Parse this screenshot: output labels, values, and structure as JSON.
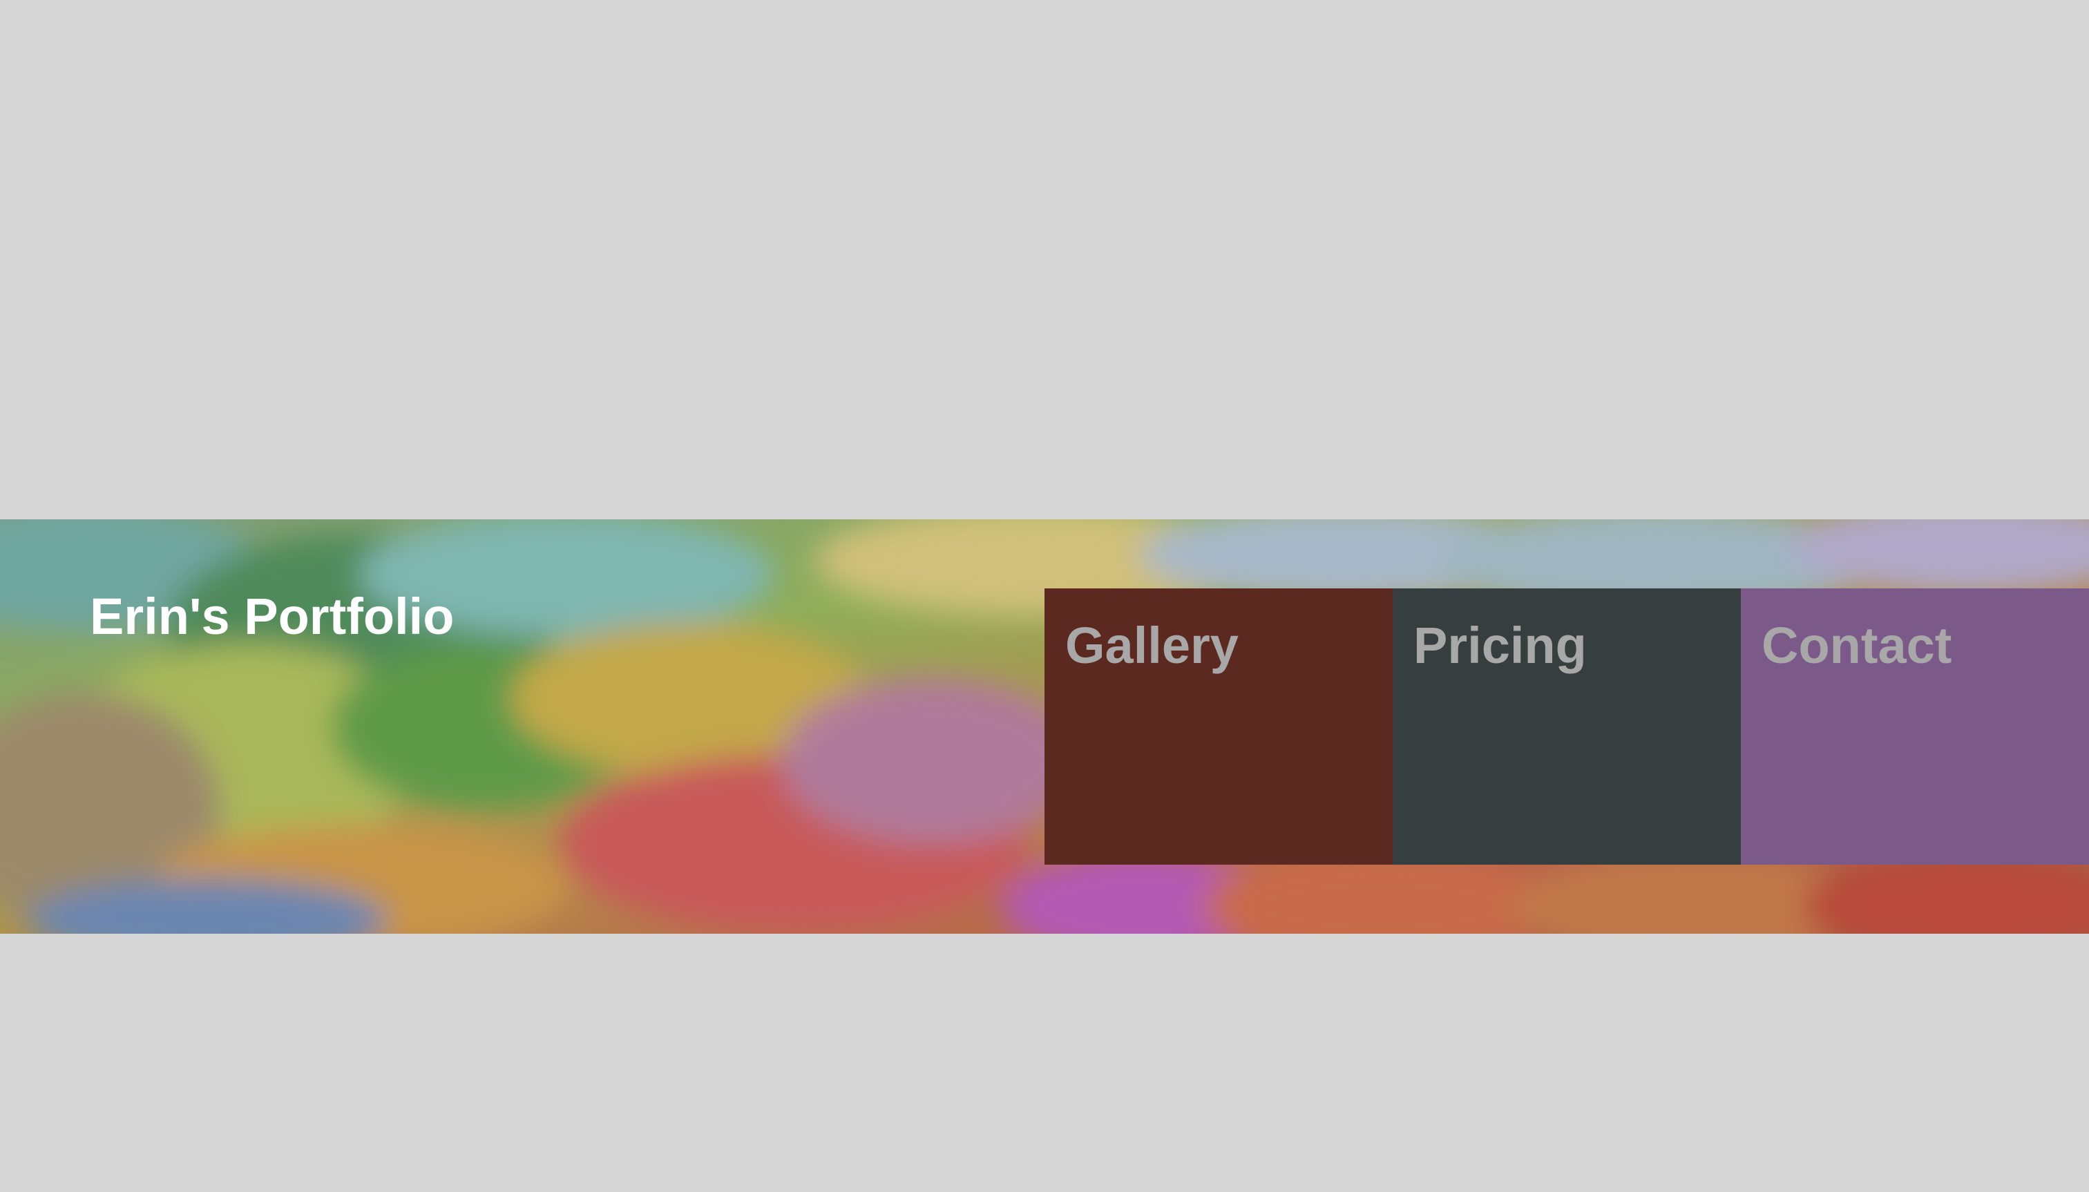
{
  "header": {
    "title": "Erin's Portfolio",
    "background": "abstract-painting-banner"
  },
  "nav": {
    "items": [
      {
        "label": "Gallery",
        "color": "#5c2921"
      },
      {
        "label": "Pricing",
        "color": "#363e40"
      },
      {
        "label": "Contact",
        "color": "#7b5a8a"
      }
    ],
    "label_color": "#a8a8a8"
  },
  "colors": {
    "page_background": "#d7d7d7",
    "title_text": "#ffffff"
  }
}
